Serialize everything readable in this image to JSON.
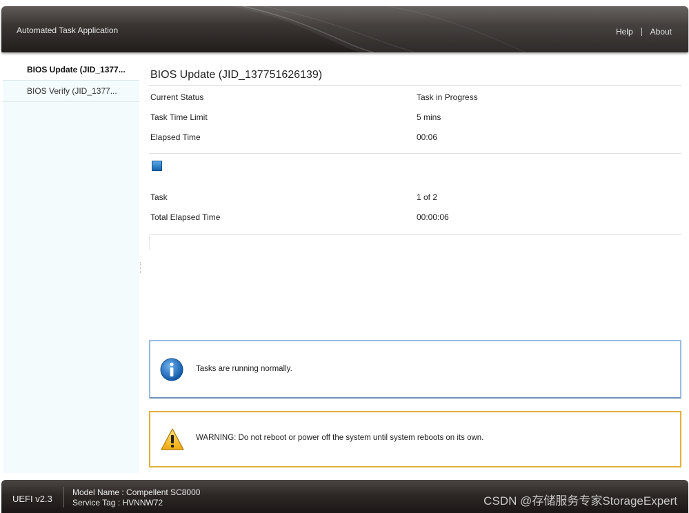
{
  "header": {
    "app_title": "Automated Task Application",
    "nav": {
      "help": "Help",
      "about": "About"
    }
  },
  "sidebar": {
    "items": [
      {
        "label": "BIOS Update (JID_1377...",
        "active": true
      },
      {
        "label": "BIOS Verify (JID_1377...",
        "active": false
      }
    ]
  },
  "job": {
    "title": "BIOS Update (JID_137751626139)",
    "details": [
      {
        "label": "Current Status",
        "value": "Task in Progress"
      },
      {
        "label": "Task Time Limit",
        "value": "5 mins"
      },
      {
        "label": "Elapsed Time",
        "value": "00:06"
      }
    ],
    "progress_fraction": 0.02,
    "summary": [
      {
        "label": "Task",
        "value": "1 of 2"
      },
      {
        "label": "Total Elapsed Time",
        "value": "00:00:06"
      }
    ]
  },
  "messages": {
    "info": {
      "icon": "info-icon",
      "text": "Tasks are running normally."
    },
    "warning": {
      "icon": "warning-icon",
      "text": "WARNING: Do not reboot or power off the system until system reboots on its own."
    }
  },
  "footer": {
    "version": "UEFI v2.3",
    "model": "Model Name : Compellent SC8000",
    "service_tag": "Service Tag : HVNNW72",
    "watermark": "CSDN @存储服务专家StorageExpert"
  },
  "colors": {
    "info_border": "#9bbbe0",
    "warning_border": "#e2b03c",
    "progress": "#1664ad",
    "sidebar_bg": "#f3fbfd"
  }
}
